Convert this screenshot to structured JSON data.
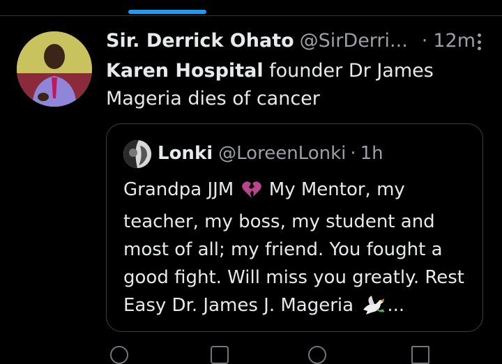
{
  "tweet": {
    "author_name": "Sir. Derrick Ohato",
    "author_handle": "@SirDerri...",
    "separator": "·",
    "time": "12m",
    "text_bold": "Karen Hospital",
    "text_rest": " founder Dr James Mageria dies of cancer"
  },
  "quote": {
    "author_name": "Lonki",
    "author_handle": "@LoreenLonki",
    "separator": "·",
    "time": "1h",
    "text_before_emoji": "Grandpa JJM",
    "emoji1": "broken-heart-icon",
    "text_after_emoji": " My Mentor, my teacher, my boss, my student and most of all; my friend. You fought a good fight. Will miss you greatly. Rest Easy Dr. James J. Mageria",
    "emoji2": "dove-icon",
    "ellipsis": "..."
  },
  "colors": {
    "background": "#000000",
    "text": "#e7e9ea",
    "secondary": "#9aa0a6",
    "accent": "#1d9bf0",
    "border": "#3a3f44"
  }
}
